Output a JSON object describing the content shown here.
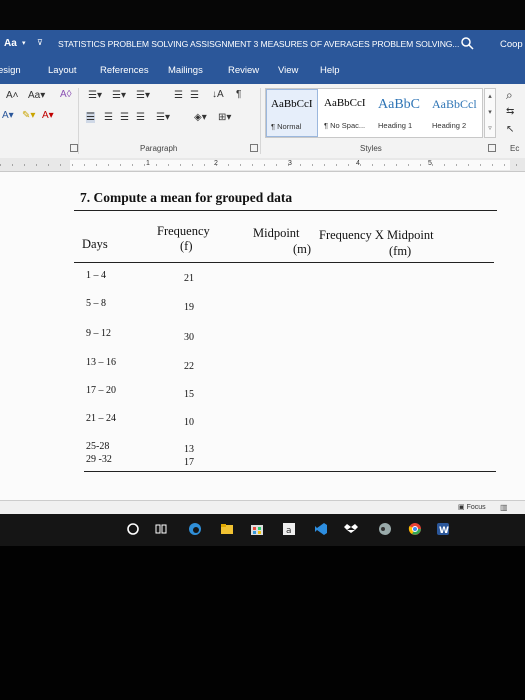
{
  "titlebar": {
    "font_button": "Aa",
    "save_glyph": "⊽",
    "document_title": "STATISTICS PROBLEM SOLVING ASSISGNMENT 3 MEASURES OF AVERAGES PROBLEM SOLVING...",
    "user_name": "Coop"
  },
  "ribbon_tabs": [
    "esign",
    "Layout",
    "References",
    "Mailings",
    "Review",
    "View",
    "Help"
  ],
  "ribbon": {
    "paragraph_label": "Paragraph",
    "styles_label": "Styles",
    "styles": [
      {
        "sample": "AaBbCcI",
        "name": "¶ Normal"
      },
      {
        "sample": "AaBbCcI",
        "name": "¶ No Spac..."
      },
      {
        "sample": "AaBbC",
        "name": "Heading 1"
      },
      {
        "sample": "AaBbCcl",
        "name": "Heading 2"
      }
    ],
    "edit_label": "Ec"
  },
  "ruler": {
    "numbers": [
      "1",
      "2",
      "3",
      "4",
      "5"
    ]
  },
  "document": {
    "heading": "7. Compute a mean for grouped data",
    "columns": {
      "days": "Days",
      "frequency_line1": "Frequency",
      "frequency_line2": "(f)",
      "midpoint_line1": "Midpoint",
      "midpoint_line2": "(m)",
      "fxm_line1": "Frequency X Midpoint",
      "fxm_line2": "(fm)"
    },
    "rows": [
      {
        "days": "1 – 4",
        "f": "21"
      },
      {
        "days": "5 – 8",
        "f": "19"
      },
      {
        "days": "9 – 12",
        "f": "30"
      },
      {
        "days": "13 – 16",
        "f": "22"
      },
      {
        "days": "17 – 20",
        "f": "15"
      },
      {
        "days": "21 – 24",
        "f": "10"
      }
    ],
    "last_rows": [
      {
        "days": "25-28",
        "f": "13"
      },
      {
        "days": "29 -32",
        "f": "17"
      }
    ]
  },
  "statusbar": {
    "focus_label": "Focus"
  },
  "colors": {
    "word_blue": "#2b579a",
    "ribbon_bg": "#f3f3f3",
    "taskbar": "#151515"
  }
}
